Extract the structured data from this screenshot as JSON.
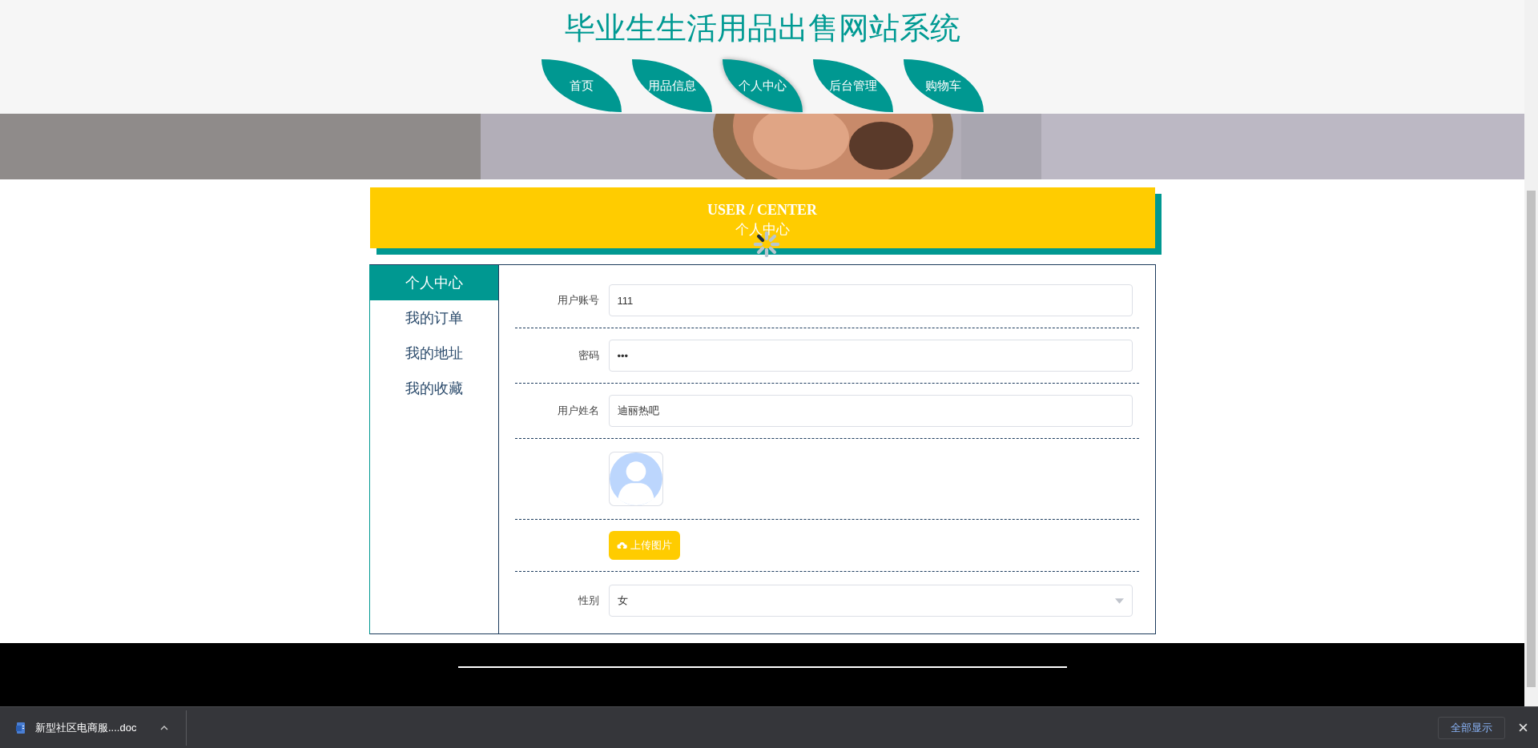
{
  "site_title": "毕业生生活用品出售网站系统",
  "nav": [
    {
      "label": "首页",
      "selected": false
    },
    {
      "label": "用品信息",
      "selected": false
    },
    {
      "label": "个人中心",
      "selected": true
    },
    {
      "label": "后台管理",
      "selected": false
    },
    {
      "label": "购物车",
      "selected": false
    }
  ],
  "section_heading": {
    "english": "USER / CENTER",
    "chinese": "个人中心"
  },
  "sidebar": {
    "items": [
      {
        "label": "个人中心",
        "selected": true
      },
      {
        "label": "我的订单",
        "selected": false
      },
      {
        "label": "我的地址",
        "selected": false
      },
      {
        "label": "我的收藏",
        "selected": false
      }
    ]
  },
  "form": {
    "fields": [
      {
        "kind": "text",
        "label": "用户账号",
        "value": "111"
      },
      {
        "kind": "text",
        "label": "密码",
        "value": "•••"
      },
      {
        "kind": "text",
        "label": "用户姓名",
        "value": "迪丽热吧"
      },
      {
        "kind": "avatar"
      },
      {
        "kind": "upload",
        "button": "上传图片"
      },
      {
        "kind": "select",
        "label": "性别",
        "value": "女"
      }
    ]
  },
  "download_bar": {
    "file": "新型社区电商服....doc",
    "show_all": "全部显示"
  }
}
